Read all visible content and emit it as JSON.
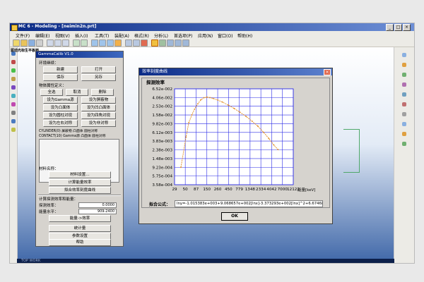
{
  "window": {
    "title": "MC 6 - Modeling - [neimin2n.prt]",
    "min_glyph": "_",
    "max_glyph": "□",
    "close_glyph": "×"
  },
  "menu": [
    "文件(F)",
    "编辑(E)",
    "视图(V)",
    "插入(I)",
    "工具(T)",
    "装配(A)",
    "格式(R)",
    "分析(L)",
    "首选项(P)",
    "应用(N)",
    "窗口(O)",
    "帮助(H)"
  ],
  "tree": {
    "heading": "驱动光标生平板桥",
    "footer": "TOP WORK"
  },
  "panel": {
    "title": "GammaCalib V1.0",
    "env_label": "环境继续：",
    "new_label": "新建",
    "open_label": "打开",
    "save_label": "保存",
    "saveas_label": "另存",
    "attr_label": "物体属性定义：",
    "all_label": "全选",
    "invert_label": "取消",
    "delete_label": "删除",
    "buttons": [
      "设为Gamma源",
      "设为屏蔽物",
      "设为凸面体",
      "设为凹凸面体",
      "设为圆柱对现",
      "设为四角对现",
      "设为左右对称",
      "设为非对称"
    ],
    "props_text1": "CYLINDER(0)  屏蔽物  凸面体  圆柱对称",
    "props_text2": "CONTACT(10)  Gamma源  凸面体  圆柱对称",
    "material_label": "材料名称：",
    "material_btn": "材料设置…",
    "calc_eff_btn": "计算能量效率",
    "eff_curve_btn": "拟合效率刻度曲线",
    "measure_label": "计算探测效率和能量：",
    "measured_eff_label": "探测效率：",
    "measured_eff_value": "0.0000",
    "energy_label": "能量水平：",
    "energy_value": "909-2400",
    "energy_eff_btn": "能量->效率",
    "stats_btn": "统计量",
    "params_btn": "参数设置",
    "help_btn": "帮助"
  },
  "dialog": {
    "title": "效率刻度曲线",
    "close_glyph": "×",
    "fit_label": "拟合公式：",
    "fit_formula": "lny=-1.015383e+003+9.068657e+002[lnx]-3.373293e+002[lnx]^2+6.674682",
    "ok_label": "OK"
  },
  "chart_data": {
    "type": "line",
    "title": "",
    "ylabel": "探测效率",
    "xlabel": "能量[keV]",
    "x_ticks": [
      "29",
      "50",
      "87",
      "150",
      "260",
      "450",
      "779",
      "1348",
      "2334",
      "4042",
      "7000",
      "12122"
    ],
    "y_ticks": [
      "3.58e-004",
      "5.75e-004",
      "9.23e-004",
      "1.48e-003",
      "2.38e-003",
      "3.83e-003",
      "6.12e-003",
      "9.82e-003",
      "1.58e-002",
      "2.53e-002",
      "4.06e-002",
      "6.52e-002"
    ],
    "x_log": true,
    "y_log": true,
    "grid": true,
    "curve_color": "#e28a1c",
    "grid_color": "#2b2be6",
    "series": [
      {
        "x": [
          40,
          52,
          60,
          70,
          80,
          95,
          110,
          130,
          150,
          175,
          210,
          260,
          330,
          450,
          600,
          800,
          1100,
          1500,
          2000,
          2700,
          3500,
          4500,
          5600
        ],
        "y": [
          0.00092,
          0.0048,
          0.0105,
          0.0159,
          0.0215,
          0.029,
          0.0358,
          0.0404,
          0.0415,
          0.0405,
          0.0385,
          0.0355,
          0.0318,
          0.0268,
          0.0225,
          0.0184,
          0.0146,
          0.0112,
          0.0086,
          0.0061,
          0.0044,
          0.0031,
          0.0024
        ]
      }
    ]
  }
}
